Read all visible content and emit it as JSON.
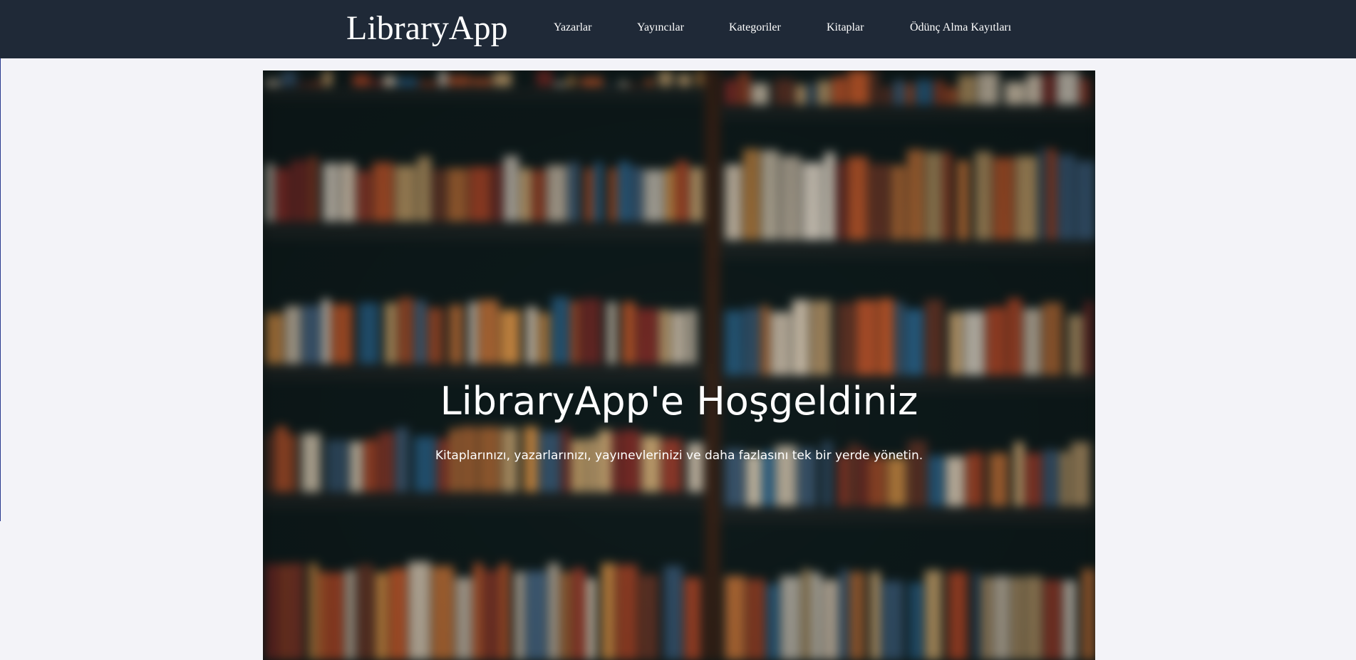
{
  "navbar": {
    "brand": "LibraryApp",
    "links": [
      {
        "label": "Yazarlar"
      },
      {
        "label": "Yayıncılar"
      },
      {
        "label": "Kategoriler"
      },
      {
        "label": "Kitaplar"
      },
      {
        "label": "Ödünç Alma Kayıtları"
      }
    ],
    "background_color": "#1f2937"
  },
  "hero": {
    "title": "LibraryApp'e Hoşgeldiniz",
    "subtitle": "Kitaplarınızı, yazarlarınızı, yayınevlerinizi ve daha fazlasını tek bir yerde yönetin."
  },
  "page": {
    "background_color": "#f3f3f8"
  }
}
